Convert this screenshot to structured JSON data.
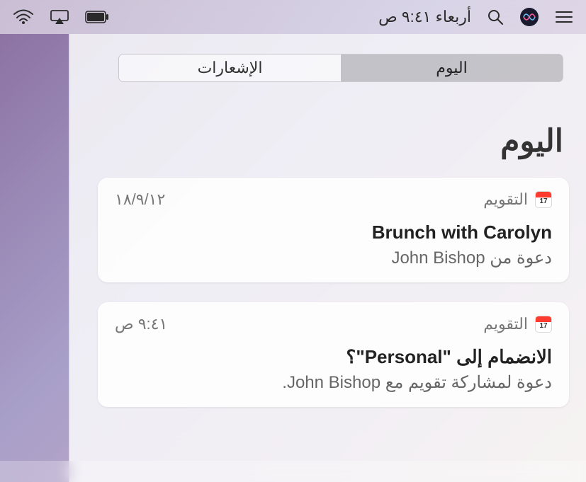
{
  "menubar": {
    "clock": "أربعاء ٩:٤١ ص"
  },
  "tabs": {
    "today": "اليوم",
    "notifications": "الإشعارات"
  },
  "heading": "اليوم",
  "cal_icon_day": "17",
  "cards": [
    {
      "app": "التقويم",
      "timestamp": "١٨/٩/١٢",
      "title": "Brunch with Carolyn",
      "subtitle": "دعوة من John Bishop"
    },
    {
      "app": "التقويم",
      "timestamp": "٩:٤١ ص",
      "title": "الانضمام إلى \"Personal\"؟",
      "subtitle": "دعوة لمشاركة تقويم مع John Bishop."
    }
  ]
}
